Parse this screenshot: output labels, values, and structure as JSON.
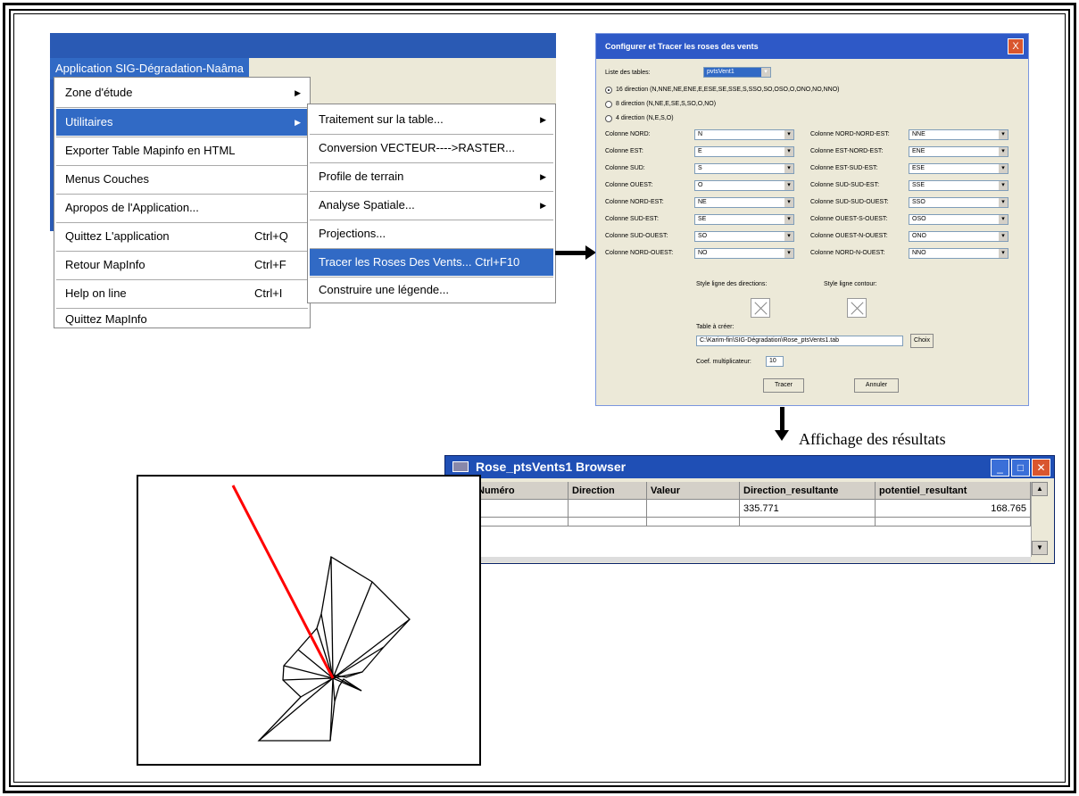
{
  "menu_bar": {
    "app_menu_label": "Application SIG-Dégradation-Naâma"
  },
  "main_menu": {
    "items": [
      {
        "label": "Zone d'étude",
        "shortcut": "",
        "submenu": true
      },
      {
        "label": "Utilitaires",
        "shortcut": "",
        "submenu": true,
        "highlighted": true
      },
      {
        "label": "Exporter Table Mapinfo en HTML",
        "shortcut": ""
      },
      {
        "label": " Menus Couches",
        "shortcut": ""
      },
      {
        "label": "Apropos de l'Application...",
        "shortcut": ""
      },
      {
        "label": "Quittez L'application",
        "shortcut": "Ctrl+Q"
      },
      {
        "label": "Retour MapInfo",
        "shortcut": "Ctrl+F"
      },
      {
        "label": "Help on line",
        "shortcut": "Ctrl+I"
      },
      {
        "label": " Quittez MapInfo",
        "shortcut": ""
      }
    ]
  },
  "sub_menu": {
    "items": [
      {
        "label": "Traitement sur la table...",
        "submenu": true
      },
      {
        "label": " Conversion VECTEUR---->RASTER..."
      },
      {
        "label": "Profile de terrain",
        "submenu": true
      },
      {
        "label": "Analyse Spatiale...",
        "submenu": true
      },
      {
        "label": "Projections..."
      },
      {
        "label": "Tracer les Roses Des Vents... Ctrl+F10",
        "highlighted": true
      },
      {
        "label": "Construire une légende..."
      }
    ]
  },
  "dialog": {
    "title": "Configurer et Tracer les roses des vents",
    "close_label": "X",
    "table_list_label": "Liste des tables:",
    "table_list_value": "pvtsVent1",
    "radio_16": "16 direction (N,NNE,NE,ENE,E,ESE,SE,SSE,S,SSO,SO,OSO,O,ONO,NO,NNO)",
    "radio_8": "8 direction (N,NE,E,SE,S,SO,O,NO)",
    "radio_4": "4 direction (N,E,S,O)",
    "left_columns": [
      {
        "label": "Colonne NORD:",
        "value": "N"
      },
      {
        "label": "Colonne EST:",
        "value": "E"
      },
      {
        "label": "Colonne SUD:",
        "value": "S"
      },
      {
        "label": "Colonne OUEST:",
        "value": "O"
      },
      {
        "label": "Colonne NORD-EST:",
        "value": "NE"
      },
      {
        "label": "Colonne SUD-EST:",
        "value": "SE"
      },
      {
        "label": "Colonne SUD-OUEST:",
        "value": "SO"
      },
      {
        "label": "Colonne NORD-OUEST:",
        "value": "NO"
      }
    ],
    "right_columns": [
      {
        "label": "Colonne NORD-NORD-EST:",
        "value": "NNE"
      },
      {
        "label": "Colonne EST-NORD-EST:",
        "value": "ENE"
      },
      {
        "label": "Colonne EST-SUD-EST:",
        "value": "ESE"
      },
      {
        "label": "Colonne SUD-SUD-EST:",
        "value": "SSE"
      },
      {
        "label": "Colonne SUD-SUD-OUEST:",
        "value": "SSO"
      },
      {
        "label": "Colonne OUEST-S-OUEST:",
        "value": "OSO"
      },
      {
        "label": "Colonne OUEST-N-OUEST:",
        "value": "ONO"
      },
      {
        "label": "Colonne NORD-N-OUEST:",
        "value": "NNO"
      }
    ],
    "style_directions_label": "Style ligne des directions:",
    "style_contour_label": "Style ligne contour:",
    "table_create_label": "Table à créer:",
    "table_path": "C:\\Karim-fin\\SIG-Dégradation\\Rose_ptsVents1.tab",
    "choose_button": "Choix",
    "coef_label": "Coef. multiplicateur:",
    "coef_value": "10",
    "trace_button": "Tracer",
    "cancel_button": "Annuler"
  },
  "result_label": "Affichage des résultats",
  "browser": {
    "title": "Rose_ptsVents1 Browser",
    "columns": [
      "Numéro",
      "Direction",
      "Valeur",
      "Direction_resultante",
      "potentiel_resultant"
    ],
    "rows": [
      [
        "",
        "",
        "",
        "335.771",
        "168.765"
      ],
      [
        "",
        "",
        "",
        "",
        ""
      ]
    ]
  },
  "colors": {
    "menu_highlight": "#316ac5",
    "title_bar": "#2e59c7",
    "resultant_vector": "#ff0000"
  }
}
